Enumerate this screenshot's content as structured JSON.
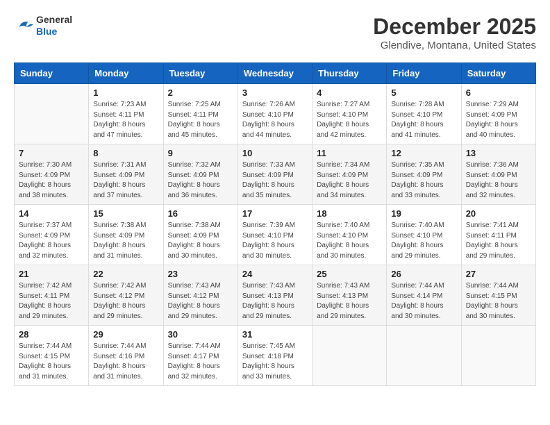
{
  "header": {
    "logo_general": "General",
    "logo_blue": "Blue",
    "title": "December 2025",
    "subtitle": "Glendive, Montana, United States"
  },
  "calendar": {
    "days_of_week": [
      "Sunday",
      "Monday",
      "Tuesday",
      "Wednesday",
      "Thursday",
      "Friday",
      "Saturday"
    ],
    "weeks": [
      [
        {
          "day": "",
          "info": ""
        },
        {
          "day": "1",
          "info": "Sunrise: 7:23 AM\nSunset: 4:11 PM\nDaylight: 8 hours\nand 47 minutes."
        },
        {
          "day": "2",
          "info": "Sunrise: 7:25 AM\nSunset: 4:11 PM\nDaylight: 8 hours\nand 45 minutes."
        },
        {
          "day": "3",
          "info": "Sunrise: 7:26 AM\nSunset: 4:10 PM\nDaylight: 8 hours\nand 44 minutes."
        },
        {
          "day": "4",
          "info": "Sunrise: 7:27 AM\nSunset: 4:10 PM\nDaylight: 8 hours\nand 42 minutes."
        },
        {
          "day": "5",
          "info": "Sunrise: 7:28 AM\nSunset: 4:10 PM\nDaylight: 8 hours\nand 41 minutes."
        },
        {
          "day": "6",
          "info": "Sunrise: 7:29 AM\nSunset: 4:09 PM\nDaylight: 8 hours\nand 40 minutes."
        }
      ],
      [
        {
          "day": "7",
          "info": "Sunrise: 7:30 AM\nSunset: 4:09 PM\nDaylight: 8 hours\nand 38 minutes."
        },
        {
          "day": "8",
          "info": "Sunrise: 7:31 AM\nSunset: 4:09 PM\nDaylight: 8 hours\nand 37 minutes."
        },
        {
          "day": "9",
          "info": "Sunrise: 7:32 AM\nSunset: 4:09 PM\nDaylight: 8 hours\nand 36 minutes."
        },
        {
          "day": "10",
          "info": "Sunrise: 7:33 AM\nSunset: 4:09 PM\nDaylight: 8 hours\nand 35 minutes."
        },
        {
          "day": "11",
          "info": "Sunrise: 7:34 AM\nSunset: 4:09 PM\nDaylight: 8 hours\nand 34 minutes."
        },
        {
          "day": "12",
          "info": "Sunrise: 7:35 AM\nSunset: 4:09 PM\nDaylight: 8 hours\nand 33 minutes."
        },
        {
          "day": "13",
          "info": "Sunrise: 7:36 AM\nSunset: 4:09 PM\nDaylight: 8 hours\nand 32 minutes."
        }
      ],
      [
        {
          "day": "14",
          "info": "Sunrise: 7:37 AM\nSunset: 4:09 PM\nDaylight: 8 hours\nand 32 minutes."
        },
        {
          "day": "15",
          "info": "Sunrise: 7:38 AM\nSunset: 4:09 PM\nDaylight: 8 hours\nand 31 minutes."
        },
        {
          "day": "16",
          "info": "Sunrise: 7:38 AM\nSunset: 4:09 PM\nDaylight: 8 hours\nand 30 minutes."
        },
        {
          "day": "17",
          "info": "Sunrise: 7:39 AM\nSunset: 4:10 PM\nDaylight: 8 hours\nand 30 minutes."
        },
        {
          "day": "18",
          "info": "Sunrise: 7:40 AM\nSunset: 4:10 PM\nDaylight: 8 hours\nand 30 minutes."
        },
        {
          "day": "19",
          "info": "Sunrise: 7:40 AM\nSunset: 4:10 PM\nDaylight: 8 hours\nand 29 minutes."
        },
        {
          "day": "20",
          "info": "Sunrise: 7:41 AM\nSunset: 4:11 PM\nDaylight: 8 hours\nand 29 minutes."
        }
      ],
      [
        {
          "day": "21",
          "info": "Sunrise: 7:42 AM\nSunset: 4:11 PM\nDaylight: 8 hours\nand 29 minutes."
        },
        {
          "day": "22",
          "info": "Sunrise: 7:42 AM\nSunset: 4:12 PM\nDaylight: 8 hours\nand 29 minutes."
        },
        {
          "day": "23",
          "info": "Sunrise: 7:43 AM\nSunset: 4:12 PM\nDaylight: 8 hours\nand 29 minutes."
        },
        {
          "day": "24",
          "info": "Sunrise: 7:43 AM\nSunset: 4:13 PM\nDaylight: 8 hours\nand 29 minutes."
        },
        {
          "day": "25",
          "info": "Sunrise: 7:43 AM\nSunset: 4:13 PM\nDaylight: 8 hours\nand 29 minutes."
        },
        {
          "day": "26",
          "info": "Sunrise: 7:44 AM\nSunset: 4:14 PM\nDaylight: 8 hours\nand 30 minutes."
        },
        {
          "day": "27",
          "info": "Sunrise: 7:44 AM\nSunset: 4:15 PM\nDaylight: 8 hours\nand 30 minutes."
        }
      ],
      [
        {
          "day": "28",
          "info": "Sunrise: 7:44 AM\nSunset: 4:15 PM\nDaylight: 8 hours\nand 31 minutes."
        },
        {
          "day": "29",
          "info": "Sunrise: 7:44 AM\nSunset: 4:16 PM\nDaylight: 8 hours\nand 31 minutes."
        },
        {
          "day": "30",
          "info": "Sunrise: 7:44 AM\nSunset: 4:17 PM\nDaylight: 8 hours\nand 32 minutes."
        },
        {
          "day": "31",
          "info": "Sunrise: 7:45 AM\nSunset: 4:18 PM\nDaylight: 8 hours\nand 33 minutes."
        },
        {
          "day": "",
          "info": ""
        },
        {
          "day": "",
          "info": ""
        },
        {
          "day": "",
          "info": ""
        }
      ]
    ]
  }
}
